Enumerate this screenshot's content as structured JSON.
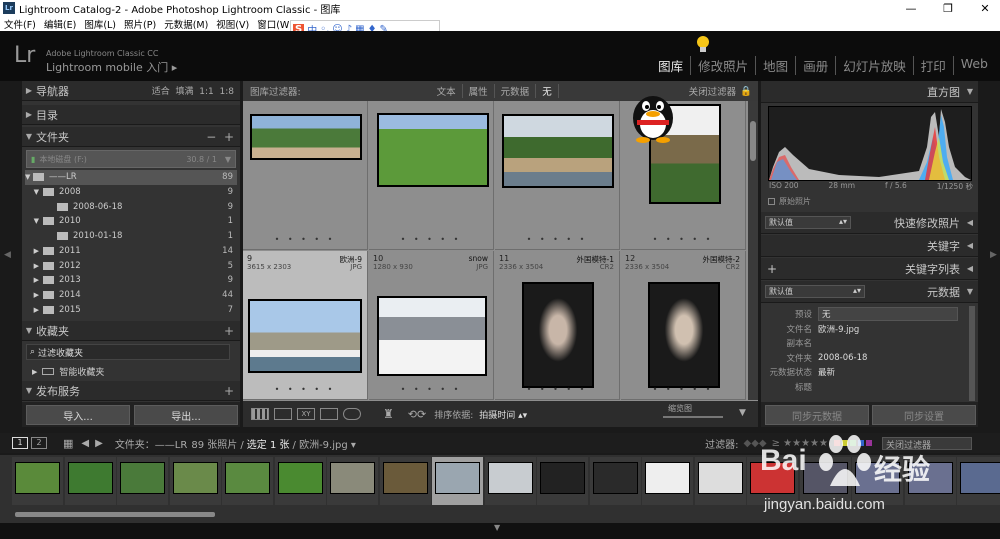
{
  "window": {
    "title": "Lightroom Catalog-2 - Adobe Photoshop Lightroom Classic - 图库",
    "min": "—",
    "max": "❐",
    "close": "✕"
  },
  "menu": [
    "文件(F)",
    "编辑(E)",
    "图库(L)",
    "照片(P)",
    "元数据(M)",
    "视图(V)",
    "窗口(W)"
  ],
  "ime": {
    "logo": "S",
    "lang": "中"
  },
  "identity": {
    "logo": "Lr",
    "line1": "Adobe Lightroom Classic CC",
    "line2": "Lightroom mobile 入门",
    "arrow": "▸"
  },
  "modules": [
    "图库",
    "修改照片",
    "地图",
    "画册",
    "幻灯片放映",
    "打印",
    "Web"
  ],
  "left_panel": {
    "navigator": {
      "label": "导航器",
      "options": [
        "适合",
        "填满",
        "1:1",
        "1:8"
      ]
    },
    "catalog": {
      "label": "目录"
    },
    "folders": {
      "label": "文件夹",
      "volume_label": "本地磁盘 (F:)",
      "volume_size": "30.8 / 1",
      "rows": [
        {
          "name": "——LR",
          "count": "89"
        },
        {
          "name": "2008",
          "count": "9"
        },
        {
          "name": "2008-06-18",
          "count": "9"
        },
        {
          "name": "2010",
          "count": "1"
        },
        {
          "name": "2010-01-18",
          "count": "1"
        },
        {
          "name": "2011",
          "count": "14"
        },
        {
          "name": "2012",
          "count": "5"
        },
        {
          "name": "2013",
          "count": "9"
        },
        {
          "name": "2014",
          "count": "44"
        },
        {
          "name": "2015",
          "count": "7"
        }
      ]
    },
    "collections": {
      "label": "收藏夹",
      "filter": "过滤收藏夹",
      "smart": "智能收藏夹"
    },
    "publish": {
      "label": "发布服务"
    },
    "import_btn": "导入...",
    "export_btn": "导出..."
  },
  "filter_bar": {
    "label": "图库过滤器:",
    "options": [
      "文本",
      "属性",
      "元数据",
      "无"
    ],
    "close": "关闭过滤器"
  },
  "grid": [
    {
      "num": "",
      "dims": "",
      "name": "",
      "ext": ""
    },
    {
      "num": "",
      "dims": "",
      "name": "",
      "ext": ""
    },
    {
      "num": "",
      "dims": "",
      "name": "",
      "ext": ""
    },
    {
      "num": "",
      "dims": "",
      "name": "",
      "ext": ""
    },
    {
      "num": "9",
      "dims": "3615 x 2303",
      "name": "欧洲-9",
      "ext": "JPG"
    },
    {
      "num": "10",
      "dims": "1280 x 930",
      "name": "snow",
      "ext": "JPG"
    },
    {
      "num": "11",
      "dims": "2336 x 3504",
      "name": "外国模特-1",
      "ext": "CR2"
    },
    {
      "num": "12",
      "dims": "2336 x 3504",
      "name": "外国模特-2",
      "ext": "CR2"
    }
  ],
  "toolbar": {
    "sort_label": "排序依据:",
    "sort_value": "拍摄时间",
    "thumb_label": "缩览图"
  },
  "right_panel": {
    "histogram": {
      "label": "直方图",
      "iso": "ISO 200",
      "focal": "28 mm",
      "aperture": "f / 5.6",
      "shutter": "1/1250 秒",
      "original": "原始照片"
    },
    "quick_develop": {
      "preset": "默认值",
      "label": "快速修改照片"
    },
    "keywording": {
      "label": "关键字"
    },
    "keyword_list": {
      "label": "关键字列表"
    },
    "metadata": {
      "preset": "默认值",
      "label": "元数据",
      "rows": [
        {
          "k": "预设",
          "v": "无"
        },
        {
          "k": "文件名",
          "v": "欧洲-9.jpg"
        },
        {
          "k": "副本名",
          "v": ""
        },
        {
          "k": "文件夹",
          "v": "2008-06-18"
        },
        {
          "k": "元数据状态",
          "v": "最新"
        },
        {
          "k": "标题",
          "v": ""
        }
      ]
    },
    "sync_meta_btn": "同步元数据",
    "sync_settings_btn": "同步设置"
  },
  "filmstrip_bar": {
    "p1": "1",
    "p2": "2",
    "source": "文件夹：——LR",
    "count": "89 张照片 /",
    "selected": "选定 1 张",
    "file": "/ 欧洲-9.jpg ▾",
    "filter": "过滤器:",
    "close": "关闭过滤器"
  },
  "watermark": {
    "brand": "Bai",
    "brand2": "经验",
    "url": "jingyan.baidu.com"
  },
  "colors": {
    "active_module": "#e8e8e8",
    "panel": "#333333",
    "grid_bg": "#8e8e8e",
    "selected": "#bcbcbc"
  }
}
